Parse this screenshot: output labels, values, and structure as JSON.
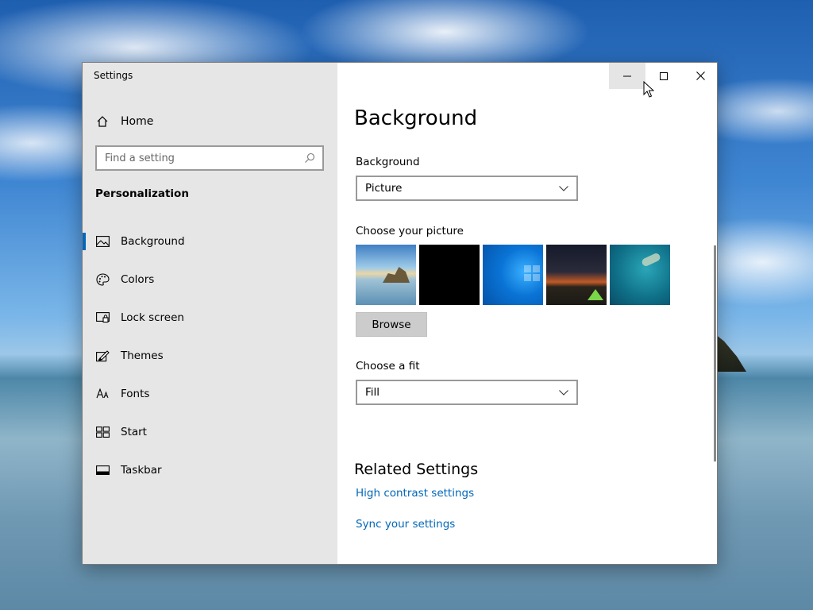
{
  "window": {
    "title": "Settings",
    "controls": {
      "minimize": "minimize",
      "maximize": "maximize",
      "close": "close"
    }
  },
  "sidebar": {
    "home_label": "Home",
    "search_placeholder": "Find a setting",
    "section_title": "Personalization",
    "items": [
      {
        "label": "Background",
        "icon": "image-icon",
        "active": true
      },
      {
        "label": "Colors",
        "icon": "palette-icon",
        "active": false
      },
      {
        "label": "Lock screen",
        "icon": "lock-screen-icon",
        "active": false
      },
      {
        "label": "Themes",
        "icon": "brush-icon",
        "active": false
      },
      {
        "label": "Fonts",
        "icon": "font-icon",
        "active": false
      },
      {
        "label": "Start",
        "icon": "start-icon",
        "active": false
      },
      {
        "label": "Taskbar",
        "icon": "taskbar-icon",
        "active": false
      }
    ]
  },
  "main": {
    "page_title": "Background",
    "background_label": "Background",
    "background_value": "Picture",
    "choose_picture_label": "Choose your picture",
    "browse_label": "Browse",
    "fit_label": "Choose a fit",
    "fit_value": "Fill",
    "related_title": "Related Settings",
    "links": [
      "High contrast settings",
      "Sync your settings"
    ]
  },
  "colors": {
    "accent": "#0067c0",
    "link": "#0067b8",
    "sidebar_bg": "#e6e6e6"
  }
}
